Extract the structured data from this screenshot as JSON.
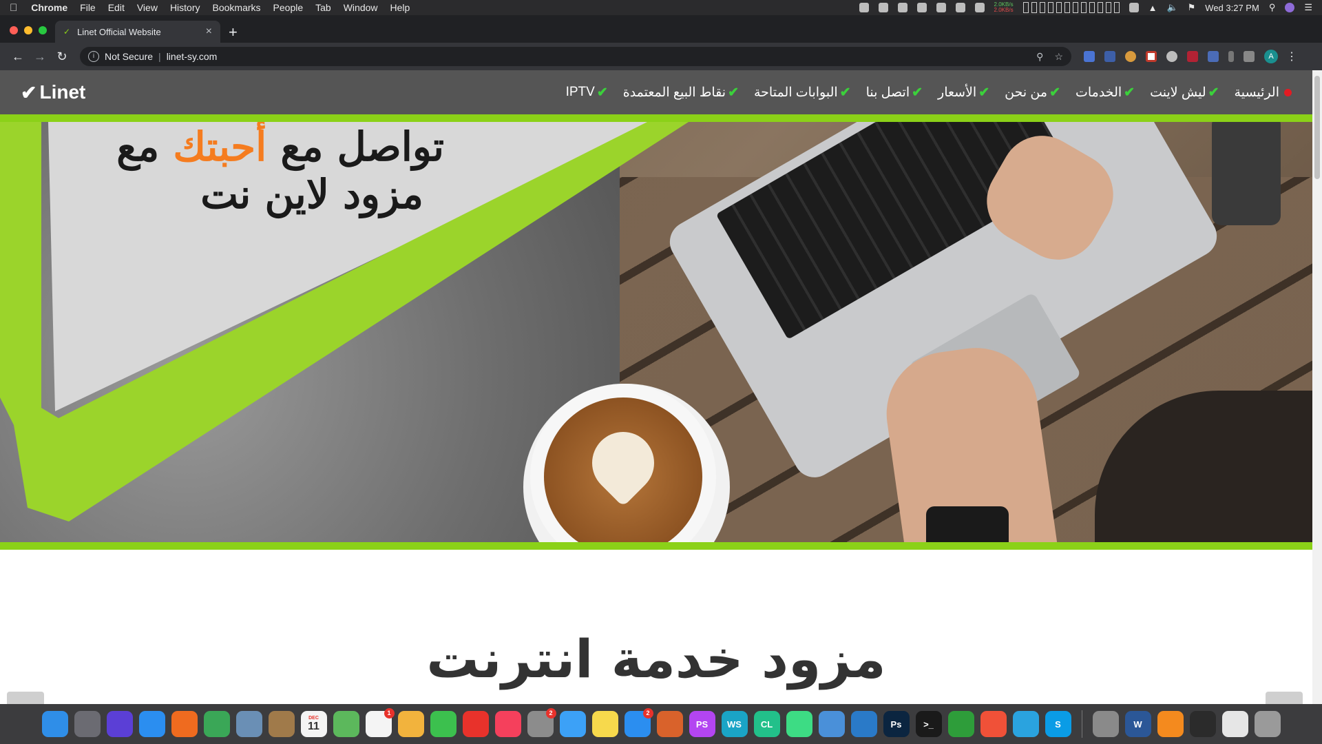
{
  "menubar": {
    "app_name": "Chrome",
    "menus": [
      "File",
      "Edit",
      "View",
      "History",
      "Bookmarks",
      "People",
      "Tab",
      "Window",
      "Help"
    ],
    "net_tx": "2.0KB/s",
    "net_rx": "2.0KB/s",
    "clock": "Wed 3:27 PM"
  },
  "browser": {
    "tab_title": "Linet Official Website",
    "security_label": "Not Secure",
    "url": "linet-sy.com",
    "profile_initial": "A"
  },
  "site": {
    "logo_text": "Linet",
    "nav": [
      {
        "label": "الرئيسية",
        "active": true
      },
      {
        "label": "ليش لاينت",
        "active": false
      },
      {
        "label": "الخدمات",
        "active": false
      },
      {
        "label": "من نحن",
        "active": false
      },
      {
        "label": "الأسعار",
        "active": false
      },
      {
        "label": "اتصل بنا",
        "active": false
      },
      {
        "label": "البوابات المتاحة",
        "active": false
      },
      {
        "label": "نقاط البيع المعتمدة",
        "active": false
      },
      {
        "label": "IPTV",
        "active": false
      }
    ],
    "hero": {
      "line1_part1": "تواصل مع",
      "line1_highlight": "أحبتك",
      "line1_part2": "مع",
      "line2": "مزود لاين نت"
    },
    "section_title": "مزود خدمة انترنت",
    "colors": {
      "accent_green": "#8bd118",
      "nav_bg": "#555555",
      "active_dot": "#e31b23",
      "highlight_orange": "#f57c1f"
    }
  },
  "dock": {
    "calendar_month": "DEC",
    "calendar_day": "11",
    "items": [
      {
        "name": "finder-icon",
        "color": "#2f8ee8",
        "label": ""
      },
      {
        "name": "launchpad-icon",
        "color": "#6b6b72",
        "label": ""
      },
      {
        "name": "siri-icon",
        "color": "#5b3fd6",
        "label": ""
      },
      {
        "name": "safari-icon",
        "color": "#2b8ef0",
        "label": ""
      },
      {
        "name": "firefox-icon",
        "color": "#ef6b1f",
        "label": ""
      },
      {
        "name": "chrome-icon",
        "color": "#3aa757",
        "label": ""
      },
      {
        "name": "preview-icon",
        "color": "#6a8fb5",
        "label": ""
      },
      {
        "name": "notefile-icon",
        "color": "#a07a4a",
        "label": ""
      },
      {
        "name": "calendar-icon",
        "color": "#f4f4f4",
        "label": ""
      },
      {
        "name": "maps-icon",
        "color": "#5cb85c",
        "label": ""
      },
      {
        "name": "reminders-icon",
        "color": "#f4f4f4",
        "label": "",
        "badge": "1"
      },
      {
        "name": "photos-icon",
        "color": "#f2b33d",
        "label": ""
      },
      {
        "name": "facetime-icon",
        "color": "#3cc04e",
        "label": ""
      },
      {
        "name": "news-icon",
        "color": "#e8322b",
        "label": ""
      },
      {
        "name": "music-icon",
        "color": "#f5405c",
        "label": ""
      },
      {
        "name": "system-preferences-icon",
        "color": "#8c8c8c",
        "label": "",
        "badge": "2"
      },
      {
        "name": "messages-icon",
        "color": "#3ca1f7",
        "label": ""
      },
      {
        "name": "notes-icon",
        "color": "#f7d94c",
        "label": ""
      },
      {
        "name": "app-store-icon",
        "color": "#2b8ef0",
        "label": "",
        "badge": "2"
      },
      {
        "name": "matlab-icon",
        "color": "#d9622b",
        "label": ""
      },
      {
        "name": "phpstorm-icon",
        "color": "#b345f1",
        "label": "PS"
      },
      {
        "name": "webstorm-icon",
        "color": "#1aa4c6",
        "label": "WS"
      },
      {
        "name": "clion-icon",
        "color": "#22c08a",
        "label": "CL"
      },
      {
        "name": "android-studio-icon",
        "color": "#3ddc84",
        "label": ""
      },
      {
        "name": "xcode-icon",
        "color": "#4a90d9",
        "label": ""
      },
      {
        "name": "vscode-icon",
        "color": "#2a7ac8",
        "label": ""
      },
      {
        "name": "photoshop-icon",
        "color": "#0b2540",
        "label": "Ps"
      },
      {
        "name": "terminal-icon",
        "color": "#1a1a1a",
        "label": ">_"
      },
      {
        "name": "crossover-icon",
        "color": "#2e9d3a",
        "label": ""
      },
      {
        "name": "swift-icon",
        "color": "#f05138",
        "label": ""
      },
      {
        "name": "telegram-icon",
        "color": "#2aa3df",
        "label": ""
      },
      {
        "name": "skype-icon",
        "color": "#0a9ce6",
        "label": "S"
      },
      {
        "name": "documents-folder-icon",
        "color": "#8a8a8a",
        "label": ""
      },
      {
        "name": "word-icon",
        "color": "#2b5797",
        "label": "W"
      },
      {
        "name": "vlc-icon",
        "color": "#f48a1e",
        "label": ""
      },
      {
        "name": "quicktime-icon",
        "color": "#2b2b2b",
        "label": ""
      },
      {
        "name": "quicktime-doc-icon",
        "color": "#e6e6e6",
        "label": ""
      },
      {
        "name": "trash-icon",
        "color": "#9a9a9a",
        "label": ""
      }
    ]
  }
}
